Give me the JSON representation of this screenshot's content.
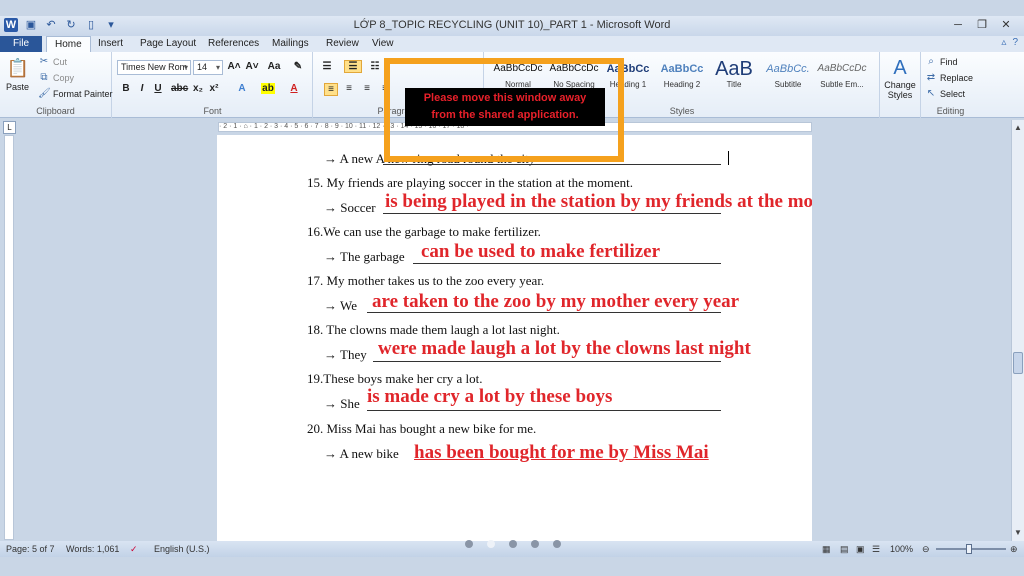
{
  "window": {
    "title": "LỚP 8_TOPIC RECYCLING (UNIT 10)_PART 1  -  Microsoft Word"
  },
  "tabs": [
    "File",
    "Home",
    "Insert",
    "Page Layout",
    "References",
    "Mailings",
    "Review",
    "View"
  ],
  "active_tab": "Home",
  "clipboard": {
    "paste": "Paste",
    "cut": "Cut",
    "copy": "Copy",
    "format_painter": "Format Painter",
    "label": "Clipboard"
  },
  "font": {
    "name": "Times New Rom",
    "size": "14",
    "label": "Font"
  },
  "paragraph": {
    "label": "Paragraph"
  },
  "styles": {
    "label": "Styles",
    "items": [
      {
        "sample": "AaBbCcDc",
        "name": "Normal"
      },
      {
        "sample": "AaBbCcDc",
        "name": "No Spacing"
      },
      {
        "sample": "AaBbCc",
        "name": "Heading 1"
      },
      {
        "sample": "AaBbCc",
        "name": "Heading 2"
      },
      {
        "sample": "AaB",
        "name": "Title"
      },
      {
        "sample": "AaBbCc.",
        "name": "Subtitle"
      },
      {
        "sample": "AaBbCcDc",
        "name": "Subtle Em..."
      }
    ],
    "change_styles": "Change Styles"
  },
  "editing": {
    "find": "Find",
    "replace": "Replace",
    "select": "Select",
    "label": "Editing"
  },
  "ruler_text": "· 2 · 1 · ⌂ · 1 · 2 · 3 · 4 · 5 · 6 · 7 · 8 · 9 · 10 · 11 · 12 · 13 · 14 · 15 · 16 · 17 · 18 ·",
  "document": {
    "partial_top": "A new ring road round the city",
    "items": [
      {
        "q": "15. My friends are playing soccer in the station at the moment.",
        "prefix": "→ Soccer",
        "answer": "is being played in the station by my friends at the moment"
      },
      {
        "q": "16.We can use the garbage to make fertilizer.",
        "prefix": "→ The garbage",
        "answer": "can be used to make fertilizer"
      },
      {
        "q": "17. My mother takes us to the zoo every year.",
        "prefix": "→ We",
        "answer": "are taken to the zoo by my mother every year"
      },
      {
        "q": "18.  The clowns made them laugh a lot last night.",
        "prefix": "→ They",
        "answer": "were made laugh a lot by the clowns last night"
      },
      {
        "q": "19.These boys make her cry a lot.",
        "prefix": "→ She",
        "answer": "is made cry a lot by these boys"
      },
      {
        "q": "20. Miss Mai has bought a new bike for me.",
        "prefix": "→ A new bike",
        "answer": "has been bought for me by Miss Mai"
      }
    ],
    "first_prefix": "→ A new"
  },
  "overlay": {
    "line1": "Please move this window away",
    "line2": "from the shared application."
  },
  "status": {
    "page": "Page: 5 of 7",
    "words": "Words: 1,061",
    "language": "English (U.S.)",
    "zoom": "100%"
  }
}
